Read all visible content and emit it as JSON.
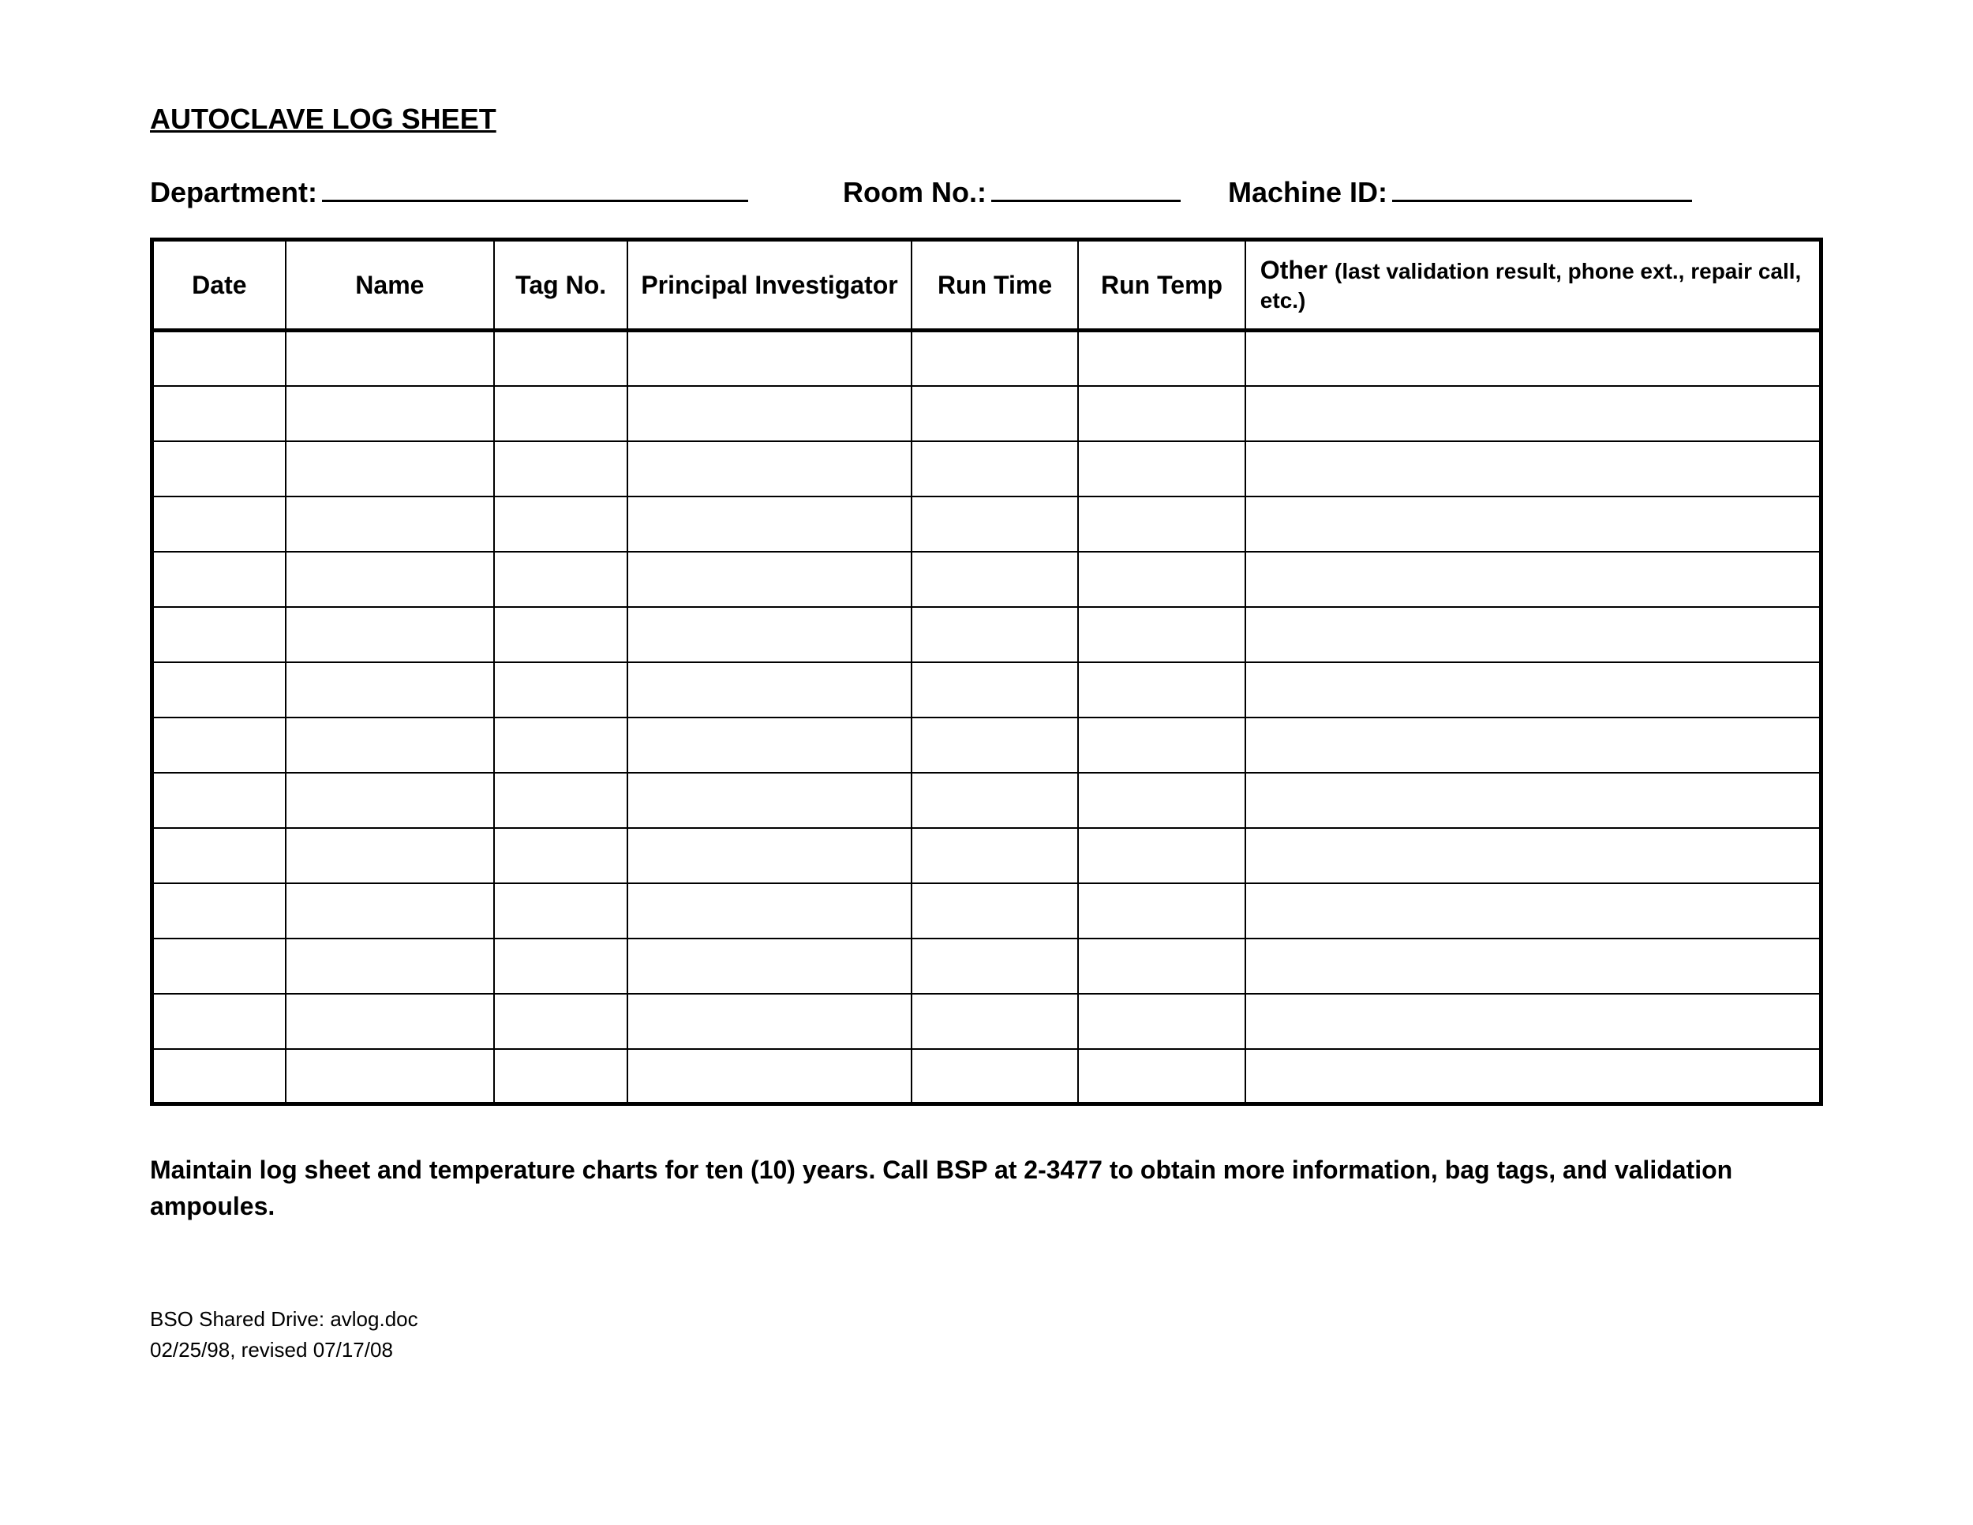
{
  "title": "AUTOCLAVE LOG SHEET",
  "meta": {
    "department_label": "Department:",
    "room_label": "Room No.:",
    "machine_label": "Machine ID:"
  },
  "columns": {
    "date": "Date",
    "name": "Name",
    "tag": "Tag No.",
    "pi": "Principal Investigator",
    "run_time": "Run Time",
    "run_temp": "Run Temp",
    "other_main": "Other ",
    "other_sub": "(last validation result, phone ext., repair call, etc.)"
  },
  "row_count": 14,
  "footer_note": "Maintain log sheet and temperature charts for ten (10) years.  Call BSP at 2-3477 to obtain more information, bag tags, and validation ampoules.",
  "doc_meta_line1": "BSO Shared Drive:  avlog.doc",
  "doc_meta_line2": "02/25/98, revised 07/17/08"
}
